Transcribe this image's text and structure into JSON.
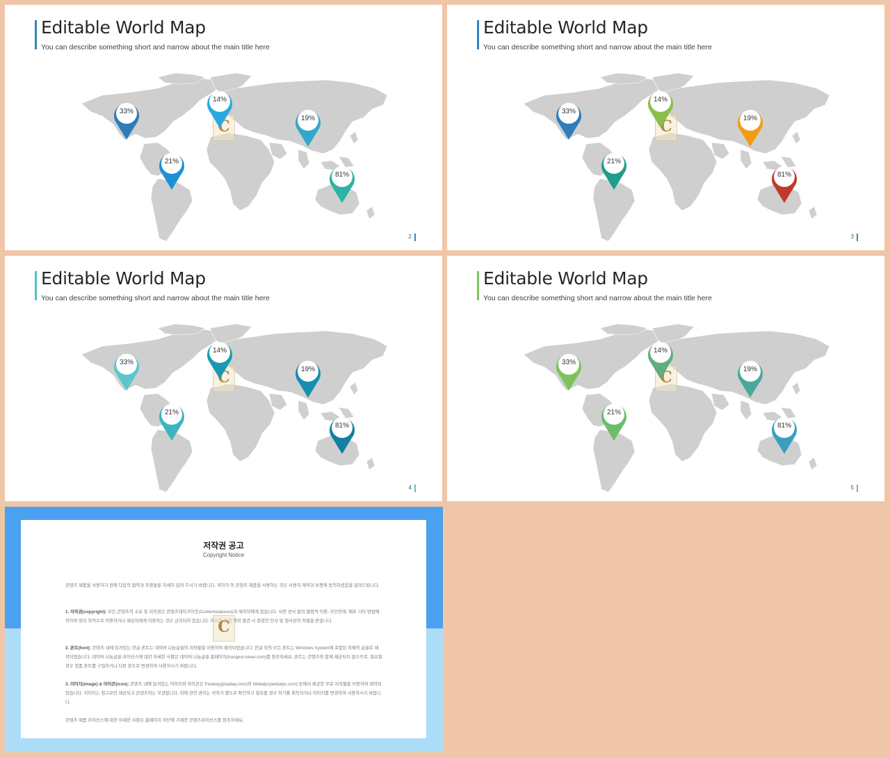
{
  "slides": [
    {
      "title": "Editable World Map",
      "subtitle": "You can describe something short and narrow about the main title here",
      "page": "2",
      "accent": "#2E86C1",
      "pins": [
        {
          "label": "33%",
          "color": "#2E7DB8"
        },
        {
          "label": "14%",
          "color": "#29A8E0"
        },
        {
          "label": "19%",
          "color": "#33A7C9"
        },
        {
          "label": "21%",
          "color": "#1E90D6"
        },
        {
          "label": "81%",
          "color": "#2BB3A3"
        }
      ]
    },
    {
      "title": "Editable World Map",
      "subtitle": "You can describe something short and narrow about the main title here",
      "page": "3",
      "accent": "#2E86C1",
      "pins": [
        {
          "label": "33%",
          "color": "#2E7DB8"
        },
        {
          "label": "14%",
          "color": "#8BBD4A"
        },
        {
          "label": "19%",
          "color": "#F39C12"
        },
        {
          "label": "21%",
          "color": "#1F9E89"
        },
        {
          "label": "81%",
          "color": "#C0392B"
        }
      ]
    },
    {
      "title": "Editable World Map",
      "subtitle": "You can describe something short and narrow about the main title here",
      "page": "4",
      "accent": "#4FC3C8",
      "pins": [
        {
          "label": "33%",
          "color": "#5CC6CC"
        },
        {
          "label": "14%",
          "color": "#1A9AB0"
        },
        {
          "label": "19%",
          "color": "#158FAE"
        },
        {
          "label": "21%",
          "color": "#3DB5C0"
        },
        {
          "label": "81%",
          "color": "#137FA3"
        }
      ]
    },
    {
      "title": "Editable World Map",
      "subtitle": "You can describe something short and narrow about the main title here",
      "page": "5",
      "accent": "#7DC35B",
      "pins": [
        {
          "label": "33%",
          "color": "#7DC35B"
        },
        {
          "label": "14%",
          "color": "#5FAF7E"
        },
        {
          "label": "19%",
          "color": "#4AA89A"
        },
        {
          "label": "21%",
          "color": "#6CBD6A"
        },
        {
          "label": "81%",
          "color": "#3A9EC0"
        }
      ]
    }
  ],
  "notice": {
    "title": "저작권 공고",
    "subtitle": "Copyright Notice",
    "intro": "콘텐츠 제품을 사용하기 전에 다음의 협약과 조항들을 자세히 읽어 주시기 바랍니다. 귀하가 이 콘텐츠 제품을 사용하는 것은 사용자 계약과 보증에 동의하셨음을 알려드립니다.",
    "p1_head": "1. 저작권(copyright):",
    "p1": "모든 콘텐츠의 소유 및 저작권은 콘텐츠테이크아웃(Contentstakeout)과 제작자에게 있습니다. 사전 승낙 없이 불법적 이용, 무단전재, 배포 기타 방법에 의하여 영리 목적으로 이용하거나 제삼자에게 이용하는 것은 금지되어 있습니다. 이러한 불법 행위 발견 시 준엄한 민사 및 형사상의 처벌을 받습니다.",
    "p2_head": "2. 폰트(font):",
    "p2": "콘텐츠 내에 담겨있는 한글 폰트는 네이버 나눔글꼴의 저작물을 이용하여 제작되었습니다. 한글 외의 모든 폰트는 Windows System에 포함된 자체의 글꼴로 제작되었습니다. 네이버 나눔글꼴 라이선스에 대한 자세한 사항은 네이버 나눔글꼴 홈페이지(hangeul.naver.com)를 참조하세요. 폰트는 콘텐츠와 함께 제공되지 않으므로, 필요할 경우 정품 폰트를 구입하거나 다른 폰트로 변경하여 사용하시기 바랍니다.",
    "p3_head": "3. 이미지(image) & 아이콘(icon):",
    "p3": "콘텐츠 내에 담겨있는 이미지와 아이콘은 Pixabay(pixabay.com)와 Webalys(webalys.com) 등에서 제공한 무료 저작물을 이용하여 제작되었습니다. 이미지는 참고로만 제공되고 콘텐츠와는 무관합니다. 이에 관한 권리는 귀하가 별도로 확인하고 필요할 경우 허가를 취득하거나 이미지를 변경하여 사용하시기 바랍니다.",
    "outro": "콘텐츠 제품 라이선스에 대한 자세한 사항은 홈페이지 하단에 기재한 콘텐츠라이선스를 참조하세요."
  }
}
